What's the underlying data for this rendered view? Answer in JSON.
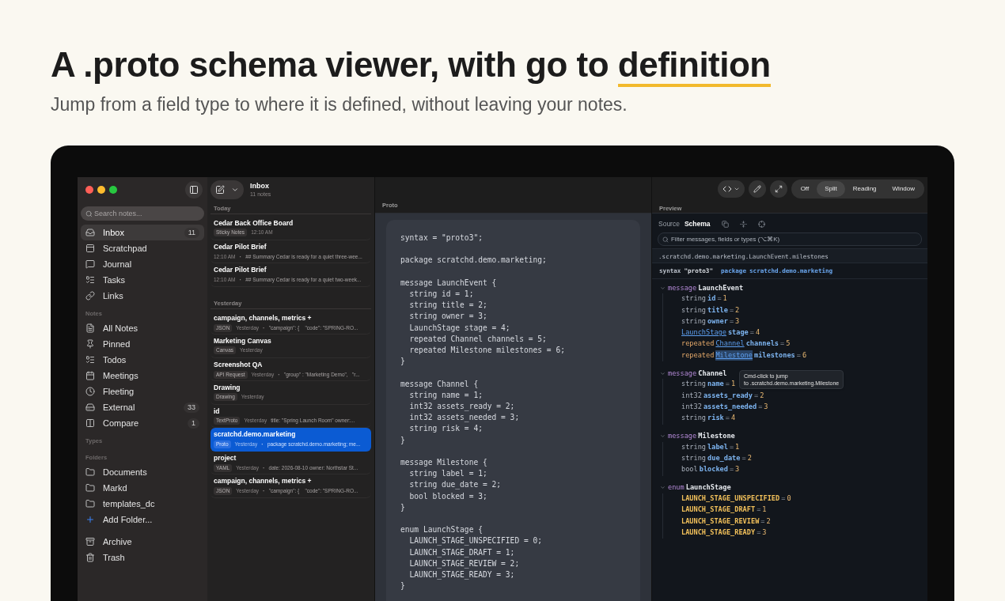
{
  "hero": {
    "title": "A .proto schema viewer, with go to",
    "title_highlight": "definition",
    "subtitle": "Jump from a field type to where it is defined, without leaving your notes."
  },
  "sidebar": {
    "search": {
      "placeholder": "Search notes..."
    },
    "sections": [
      {
        "items": [
          {
            "label": "Inbox",
            "count": "11",
            "selected": true
          },
          {
            "label": "Scratchpad",
            "selected": false
          },
          {
            "label": "Journal",
            "selected": false
          },
          {
            "label": "Tasks",
            "selected": false
          },
          {
            "label": "Links",
            "selected": false
          }
        ]
      },
      {
        "heading": "Notes",
        "items": [
          {
            "label": "All Notes",
            "selected": false
          },
          {
            "label": "Pinned",
            "selected": false
          },
          {
            "label": "Todos",
            "selected": false
          },
          {
            "label": "Meetings",
            "selected": false
          },
          {
            "label": "Fleeting",
            "selected": false
          },
          {
            "label": "External",
            "count": "33",
            "selected": false
          },
          {
            "label": "Compare",
            "count": "1",
            "selected": false
          }
        ]
      },
      {
        "heading": "Types"
      },
      {
        "heading": "Folders",
        "items": [
          {
            "label": "Documents",
            "kind": "folder",
            "selected": false
          },
          {
            "label": "Markd",
            "kind": "folder",
            "selected": false
          },
          {
            "label": "templates_dc",
            "kind": "folder",
            "selected": false
          },
          {
            "label": "Add Folder...",
            "kind": "add",
            "selected": false
          }
        ]
      },
      {
        "items": [
          {
            "label": "Archive",
            "selected": false
          },
          {
            "label": "Trash",
            "selected": false
          }
        ]
      }
    ]
  },
  "note_list": {
    "title": "Inbox",
    "subtitle": "11 notes",
    "groups": [
      {
        "label": "Today",
        "notes": [
          {
            "title": "Cedar Back Office Board",
            "tag": "Sticky Notes",
            "time": "12:10 AM",
            "selected": false
          },
          {
            "title": "Cedar Pilot Brief",
            "time": "12:10 AM",
            "separator": "·",
            "preview": "## Summary Cedar is ready for a quiet three-wee...",
            "selected": false
          },
          {
            "title": "Cedar Pilot Brief",
            "time": "12:10 AM",
            "separator": "·",
            "preview": "## Summary Cedar is ready for a quiet two-week...",
            "selected": false
          }
        ]
      },
      {
        "label": "Yesterday",
        "notes": [
          {
            "title": "campaign, channels, metrics +",
            "tag": "JSON",
            "time": "Yesterday",
            "separator": "·",
            "preview": "\"campaign\": {    \"code\": \"SPRING-RO...",
            "selected": false
          },
          {
            "title": "Marketing Canvas",
            "tag": "Canvas",
            "time": "Yesterday",
            "selected": false
          },
          {
            "title": "Screenshot QA",
            "tag": "API Request",
            "time": "Yesterday",
            "separator": "·",
            "preview": "\"group\" : \"Marketing Demo\",   \"r...",
            "selected": false
          },
          {
            "title": "Drawing",
            "tag": "Drawing",
            "time": "Yesterday",
            "selected": false
          },
          {
            "title": "id",
            "tag": "TextProto",
            "time": "Yesterday",
            "preview": "title: \"Spring Launch Room\" owner:...",
            "selected": false
          },
          {
            "title": "scratchd.demo.marketing",
            "tag": "Proto",
            "time": "Yesterday",
            "separator": "·",
            "preview": "package scratchd.demo.marketing; me...",
            "selected": true
          },
          {
            "title": "project",
            "tag": "YAML",
            "time": "Yesterday",
            "separator": "·",
            "preview": "date: 2026-08-10 owner: Northstar St...",
            "selected": false
          },
          {
            "title": "campaign, channels, metrics +",
            "tag": "JSON",
            "time": "Yesterday",
            "separator": "·",
            "preview": "\"campaign\": {    \"code\": \"SPRING-RO...",
            "selected": false
          }
        ]
      }
    ]
  },
  "editor": {
    "label": "Proto",
    "blocks": [
      [
        "syntax = \"proto3\";"
      ],
      [
        "package scratchd.demo.marketing;"
      ],
      [
        "message LaunchEvent {",
        "  string id = 1;",
        "  string title = 2;",
        "  string owner = 3;",
        "  LaunchStage stage = 4;",
        "  repeated Channel channels = 5;",
        "  repeated Milestone milestones = 6;",
        "}"
      ],
      [
        "message Channel {",
        "  string name = 1;",
        "  int32 assets_ready = 2;",
        "  int32 assets_needed = 3;",
        "  string risk = 4;",
        "}"
      ],
      [
        "message Milestone {",
        "  string label = 1;",
        "  string due_date = 2;",
        "  bool blocked = 3;",
        "}"
      ],
      [
        "enum LaunchStage {",
        "  LAUNCH_STAGE_UNSPECIFIED = 0;",
        "  LAUNCH_STAGE_DRAFT = 1;",
        "  LAUNCH_STAGE_REVIEW = 2;",
        "  LAUNCH_STAGE_READY = 3;",
        "}"
      ]
    ]
  },
  "preview": {
    "modes": [
      {
        "label": "Off",
        "selected": false
      },
      {
        "label": "Split",
        "selected": true
      },
      {
        "label": "Reading",
        "selected": false
      },
      {
        "label": "Window",
        "selected": false
      }
    ],
    "label": "Preview",
    "tabs": [
      {
        "label": "Source",
        "selected": false
      },
      {
        "label": "Schema",
        "selected": true
      }
    ],
    "filter": {
      "placeholder": "Filter messages, fields or types (⌥⌘K)"
    },
    "path": ".scratchd.demo.marketing.LaunchEvent.milestones",
    "header": {
      "syntax_keyword": "syntax",
      "syntax_value": "\"proto3\"",
      "package_keyword": "package",
      "package_value": "scratchd.demo.marketing"
    },
    "definitions": [
      {
        "kind": "message",
        "keyword": "message",
        "name": "LaunchEvent",
        "expanded": true,
        "fields": [
          {
            "type": "string",
            "link": false,
            "name": "id",
            "eq": "=",
            "number": "1"
          },
          {
            "type": "string",
            "link": false,
            "name": "title",
            "eq": "=",
            "number": "2"
          },
          {
            "type": "string",
            "link": false,
            "name": "owner",
            "eq": "=",
            "number": "3"
          },
          {
            "type": "LaunchStage",
            "link": true,
            "name": "stage",
            "eq": "=",
            "number": "4"
          },
          {
            "label": "repeated",
            "type": "Channel",
            "link": true,
            "name": "channels",
            "eq": "=",
            "number": "5"
          },
          {
            "label": "repeated",
            "type": "Milestone",
            "link": true,
            "hovered": true,
            "name": "milestones",
            "eq": "=",
            "number": "6"
          }
        ]
      },
      {
        "kind": "message",
        "keyword": "message",
        "name": "Channel",
        "expanded": true,
        "fields": [
          {
            "type": "string",
            "link": false,
            "name": "name",
            "eq": "=",
            "number": "1"
          },
          {
            "type": "int32",
            "link": false,
            "name": "assets_ready",
            "eq": "=",
            "number": "2"
          },
          {
            "type": "int32",
            "link": false,
            "name": "assets_needed",
            "eq": "=",
            "number": "3"
          },
          {
            "type": "string",
            "link": false,
            "name": "risk",
            "eq": "=",
            "number": "4"
          }
        ]
      },
      {
        "kind": "message",
        "keyword": "message",
        "name": "Milestone",
        "expanded": true,
        "fields": [
          {
            "type": "string",
            "link": false,
            "name": "label",
            "eq": "=",
            "number": "1"
          },
          {
            "type": "string",
            "link": false,
            "name": "due_date",
            "eq": "=",
            "number": "2"
          },
          {
            "type": "bool",
            "link": false,
            "name": "blocked",
            "eq": "=",
            "number": "3"
          }
        ]
      },
      {
        "kind": "enum",
        "keyword": "enum",
        "name": "LaunchStage",
        "expanded": true,
        "values": [
          {
            "name": "LAUNCH_STAGE_UNSPECIFIED",
            "eq": "=",
            "number": "0"
          },
          {
            "name": "LAUNCH_STAGE_DRAFT",
            "eq": "=",
            "number": "1"
          },
          {
            "name": "LAUNCH_STAGE_REVIEW",
            "eq": "=",
            "number": "2"
          },
          {
            "name": "LAUNCH_STAGE_READY",
            "eq": "=",
            "number": "3"
          }
        ]
      }
    ],
    "tooltip": [
      "Cmd-click to jump",
      "to .scratchd.demo.marketing.Milestone"
    ]
  }
}
